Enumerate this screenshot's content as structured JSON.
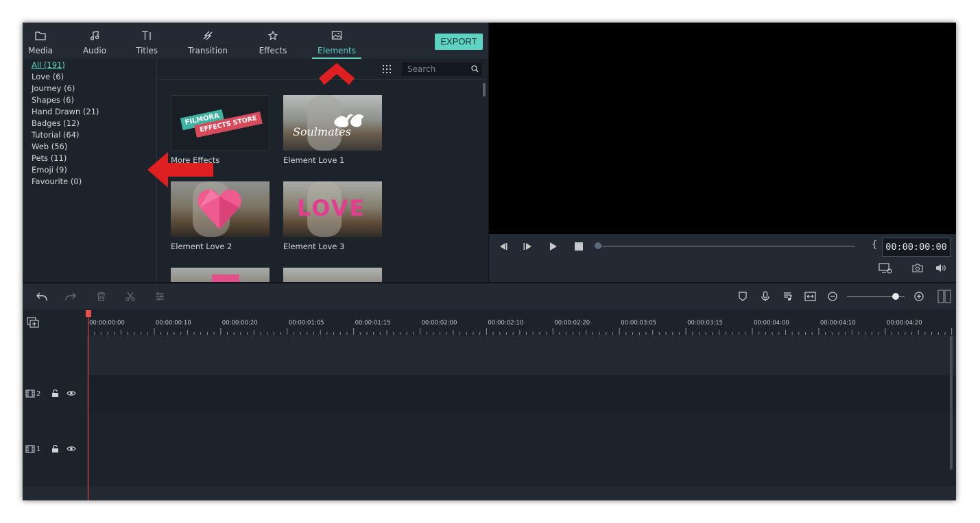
{
  "tabs": [
    {
      "label": "Media",
      "icon": "folder-icon"
    },
    {
      "label": "Audio",
      "icon": "music-note-icon"
    },
    {
      "label": "Titles",
      "icon": "text-icon"
    },
    {
      "label": "Transition",
      "icon": "transition-icon"
    },
    {
      "label": "Effects",
      "icon": "effects-icon"
    },
    {
      "label": "Elements",
      "icon": "image-icon",
      "active": true
    }
  ],
  "export_label": "EXPORT",
  "categories": [
    "All (191)",
    "Love (6)",
    "Journey (6)",
    "Shapes (6)",
    "Hand Drawn (21)",
    "Badges (12)",
    "Tutorial (64)",
    "Web (56)",
    "Pets (11)",
    "Emoji (9)",
    "Favourite (0)"
  ],
  "search": {
    "placeholder": "Search"
  },
  "thumbnails": [
    {
      "label": "More Effects",
      "banner_top": "FILMORA",
      "banner_bottom": "EFFECTS STORE"
    },
    {
      "label": "Element Love 1",
      "overlay": "Soulmates"
    },
    {
      "label": "Element Love 2"
    },
    {
      "label": "Element Love 3",
      "overlay": "LOVE"
    }
  ],
  "preview": {
    "timecode": "00:00:00:00",
    "brackets": "{ }"
  },
  "timeline": {
    "ruler_labels": [
      "00:00:00:00",
      "00:00:00:10",
      "00:00:00:20",
      "00:00:01:05",
      "00:00:01:15",
      "00:00:02:00",
      "00:00:02:10",
      "00:00:02:20",
      "00:00:03:05",
      "00:00:03:15",
      "00:00:04:00",
      "00:00:04:10",
      "00:00:04:20"
    ],
    "tracks": [
      {
        "number": "2"
      },
      {
        "number": "1"
      }
    ]
  },
  "colors": {
    "accent": "#5fd3c3",
    "playhead": "#e8504a",
    "annotation": "#e02020"
  }
}
